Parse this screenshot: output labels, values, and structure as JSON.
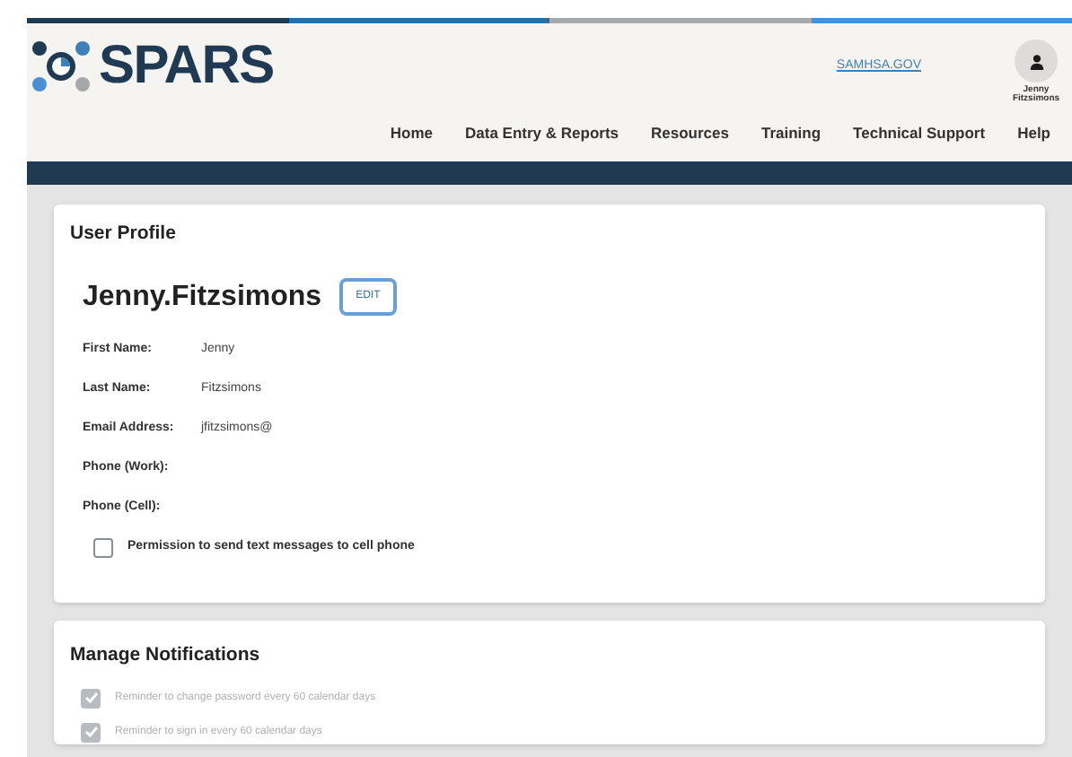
{
  "header": {
    "logo": "SPARS",
    "link": "SAMHSA.GOV",
    "user": {
      "first": "Jenny",
      "last": "Fitzsimons"
    }
  },
  "nav": [
    {
      "label": "Home"
    },
    {
      "label": "Data Entry & Reports"
    },
    {
      "label": "Resources"
    },
    {
      "label": "Training"
    },
    {
      "label": "Technical Support"
    },
    {
      "label": "Help"
    }
  ],
  "profile": {
    "title": "User Profile",
    "username": "Jenny.Fitzsimons",
    "edit": "EDIT",
    "fields": [
      {
        "label": "First Name:",
        "value": "Jenny"
      },
      {
        "label": "Last Name:",
        "value": "Fitzsimons"
      },
      {
        "label": "Email Address:",
        "value": "jfitzsimons@"
      },
      {
        "label": "Phone (Work):"
      },
      {
        "label": "Phone (Cell):"
      }
    ],
    "permission": {
      "label": "Permission to send text messages to cell phone",
      "checked": false
    }
  },
  "notifications": {
    "title": "Manage Notifications",
    "items": [
      {
        "label": "Reminder to change password every 60 calendar days",
        "checked": true,
        "disabled": true
      },
      {
        "label": "Reminder to sign in every 60 calendar days",
        "checked": true,
        "disabled": true
      }
    ]
  }
}
